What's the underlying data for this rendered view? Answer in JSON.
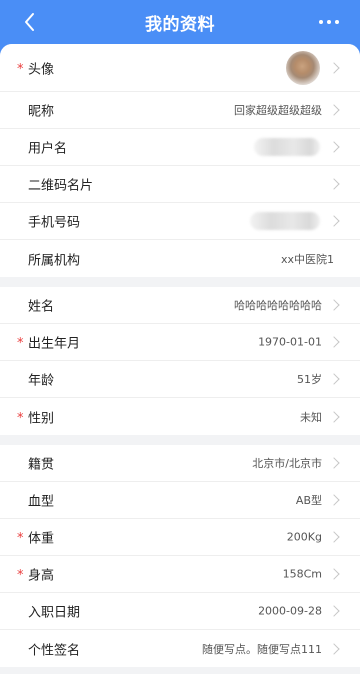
{
  "header": {
    "title": "我的资料"
  },
  "sections": [
    {
      "rows": [
        {
          "label": "头像",
          "required": true,
          "type": "avatar",
          "value": ""
        },
        {
          "label": "昵称",
          "required": false,
          "type": "text",
          "value": "回家超级超级超级"
        },
        {
          "label": "用户名",
          "required": false,
          "type": "blurred",
          "value": ""
        },
        {
          "label": "二维码名片",
          "required": false,
          "type": "text",
          "value": ""
        },
        {
          "label": "手机号码",
          "required": false,
          "type": "blurred",
          "value": ""
        },
        {
          "label": "所属机构",
          "required": false,
          "type": "text",
          "value": "xx中医院1",
          "no_arrow": true
        }
      ]
    },
    {
      "rows": [
        {
          "label": "姓名",
          "required": false,
          "type": "text",
          "value": "哈哈哈哈哈哈哈哈"
        },
        {
          "label": "出生年月",
          "required": true,
          "type": "text",
          "value": "1970-01-01"
        },
        {
          "label": "年龄",
          "required": false,
          "type": "text",
          "value": "51岁"
        },
        {
          "label": "性别",
          "required": true,
          "type": "text",
          "value": "未知"
        }
      ]
    },
    {
      "rows": [
        {
          "label": "籍贯",
          "required": false,
          "type": "text",
          "value": "北京市/北京市"
        },
        {
          "label": "血型",
          "required": false,
          "type": "text",
          "value": "AB型"
        },
        {
          "label": "体重",
          "required": true,
          "type": "text",
          "value": "200Kg"
        },
        {
          "label": "身高",
          "required": true,
          "type": "text",
          "value": "158Cm"
        },
        {
          "label": "入职日期",
          "required": false,
          "type": "text",
          "value": "2000-09-28"
        },
        {
          "label": "个性签名",
          "required": false,
          "type": "text",
          "value": "随便写点。随便写点111"
        }
      ]
    }
  ],
  "colors": {
    "header_bg": "#4a8ef6",
    "required_star": "#e93b3b",
    "page_bg": "#f2f3f5"
  },
  "icons": {
    "back": "chevron-left-icon",
    "more": "more-dots-icon",
    "row_arrow": "chevron-right-icon"
  }
}
